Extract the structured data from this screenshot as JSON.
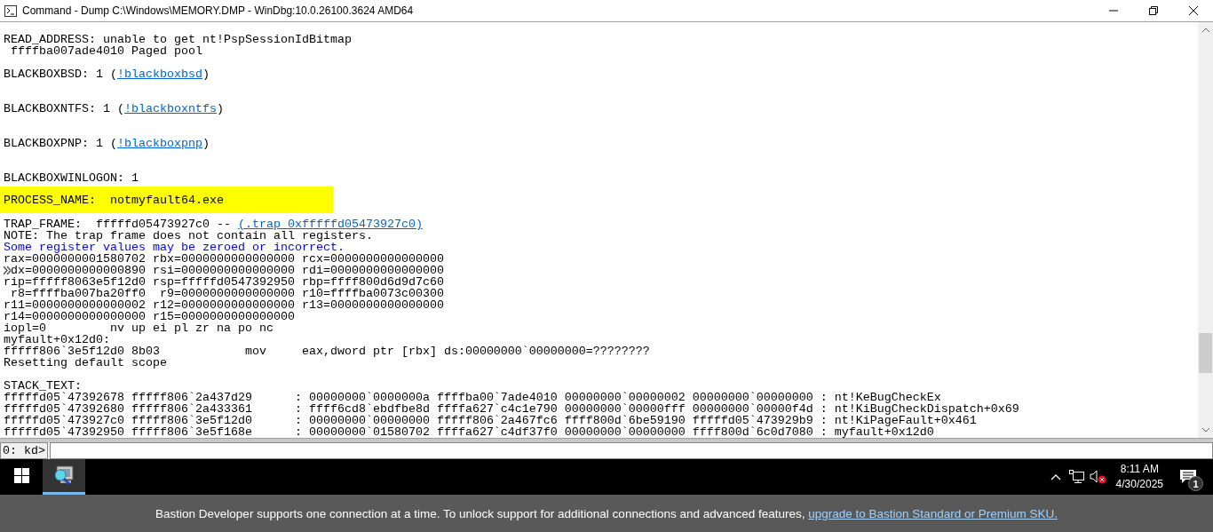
{
  "window": {
    "title": "Command - Dump C:\\Windows\\MEMORY.DMP - WinDbg:10.0.26100.3624 AMD64"
  },
  "output": {
    "lines": [
      {
        "kind": "blank"
      },
      {
        "kind": "text",
        "text": "READ_ADDRESS: unable to get nt!PspSessionIdBitmap"
      },
      {
        "kind": "text",
        "text": " ffffba007ade4010 Paged pool"
      },
      {
        "kind": "blank"
      },
      {
        "kind": "link",
        "text": "BLACKBOXBSD: 1 (",
        "link": "!blackboxbsd",
        "after": ")"
      },
      {
        "kind": "blank"
      },
      {
        "kind": "blank"
      },
      {
        "kind": "link",
        "text": "BLACKBOXNTFS: 1 (",
        "link": "!blackboxntfs",
        "after": ")"
      },
      {
        "kind": "blank"
      },
      {
        "kind": "blank"
      },
      {
        "kind": "link",
        "text": "BLACKBOXPNP: 1 (",
        "link": "!blackboxpnp",
        "after": ")"
      },
      {
        "kind": "blank"
      },
      {
        "kind": "blank"
      },
      {
        "kind": "text",
        "text": "BLACKBOXWINLOGON: 1"
      },
      {
        "kind": "highlight",
        "text": "PROCESS_NAME:  notmyfault64.exe"
      },
      {
        "kind": "link",
        "text": "TRAP_FRAME:  fffffd05473927c0 -- ",
        "link": "(.trap 0xfffffd05473927c0)"
      },
      {
        "kind": "text",
        "text": "NOTE: The trap frame does not contain all registers."
      },
      {
        "kind": "warning",
        "text": "Some register values may be zeroed or incorrect."
      },
      {
        "kind": "text",
        "text": "rax=0000000001580702 rbx=0000000000000000 rcx=0000000000000000"
      },
      {
        "kind": "marked",
        "text": "dx=0000000000000890 rsi=0000000000000000 rdi=0000000000000000"
      },
      {
        "kind": "text",
        "text": "rip=fffff8063e5f12d0 rsp=fffffd0547392950 rbp=ffff800d6d9d7c60"
      },
      {
        "kind": "text",
        "text": " r8=ffffba007ba20ff0  r9=0000000000000000 r10=ffffba0073c00300"
      },
      {
        "kind": "text",
        "text": "r11=0000000000000002 r12=0000000000000000 r13=0000000000000000"
      },
      {
        "kind": "text",
        "text": "r14=0000000000000000 r15=0000000000000000"
      },
      {
        "kind": "text",
        "text": "iopl=0         nv up ei pl zr na po nc"
      },
      {
        "kind": "text",
        "text": "myfault+0x12d0:"
      },
      {
        "kind": "text",
        "text": "fffff806`3e5f12d0 8b03            mov     eax,dword ptr [rbx] ds:00000000`00000000=????????"
      },
      {
        "kind": "text",
        "text": "Resetting default scope"
      },
      {
        "kind": "blank"
      },
      {
        "kind": "text",
        "text": "STACK_TEXT:"
      },
      {
        "kind": "text",
        "text": "fffffd05`47392678 fffff806`2a437d29      : 00000000`0000000a ffffba00`7ade4010 00000000`00000002 00000000`00000000 : nt!KeBugCheckEx"
      },
      {
        "kind": "text",
        "text": "fffffd05`47392680 fffff806`2a433361      : ffff6cd8`ebdfbe8d ffffa627`c4c1e790 00000000`00000fff 00000000`00000f4d : nt!KiBugCheckDispatch+0x69"
      },
      {
        "kind": "text",
        "text": "fffffd05`473927c0 fffff806`3e5f12d0      : 00000000`00000000 fffff806`2a467fc6 ffff800d`6be59190 fffffd05`473929b9 : nt!KiPageFault+0x461"
      },
      {
        "kind": "text",
        "text": "fffffd05`47392950 fffff806`3e5f168e      : 00000000`01580702 ffffa627`c4df37f0 00000000`00000000 ffff800d`6c0d7080 : myfault+0x12d0"
      }
    ]
  },
  "command": {
    "prompt": "0: kd>"
  },
  "taskbar": {
    "apps": [
      {
        "selected": true
      }
    ],
    "speaker": {
      "muted": true
    },
    "clock": {
      "time": "8:11 AM",
      "date": "4/30/2025"
    },
    "notifications": {
      "count": "1"
    }
  },
  "banner": {
    "text": "Bastion Developer supports one connection at a time. To unlock support for additional connections and advanced features, ",
    "link": "upgrade to Bastion Standard or Premium SKU."
  }
}
